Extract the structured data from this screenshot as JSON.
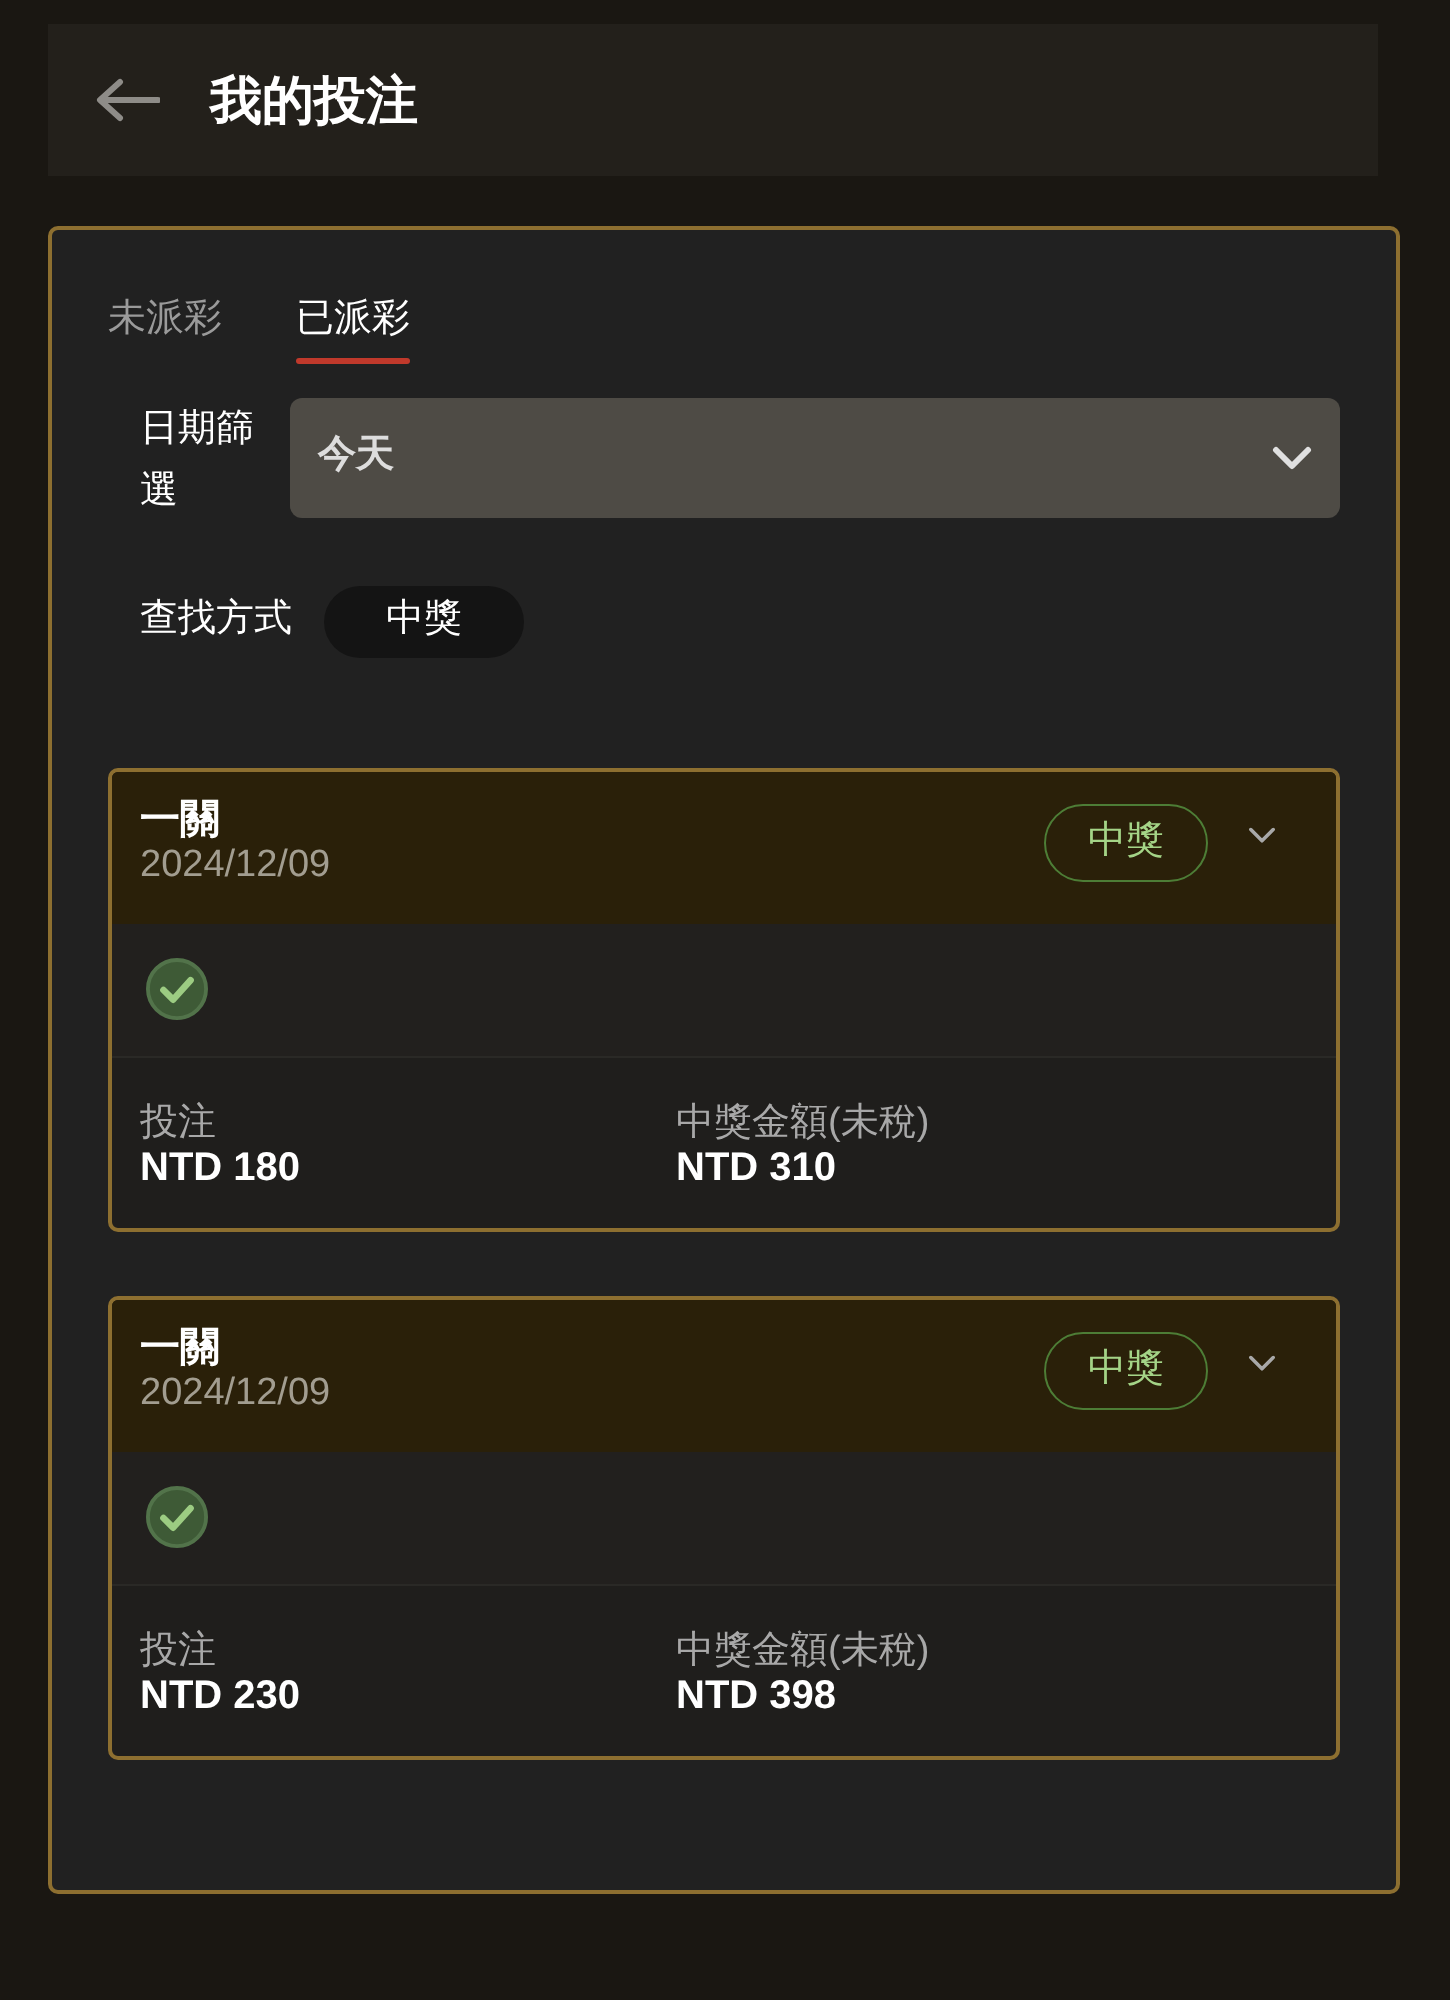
{
  "header": {
    "title": "我的投注"
  },
  "tabs": [
    {
      "label": "未派彩",
      "selected": false
    },
    {
      "label": "已派彩",
      "selected": true
    }
  ],
  "date_filter": {
    "label": "日期篩選",
    "value": "今天"
  },
  "search_method": {
    "label": "查找方式",
    "value": "中獎"
  },
  "bets": [
    {
      "title": "一關",
      "date": "2024/12/09",
      "status": {
        "label": "中獎",
        "kind": "won"
      },
      "legs": [
        {
          "won": true
        }
      ],
      "stake_label": "投注",
      "stake": "NTD 180",
      "payout_label": "中獎金額(未稅)",
      "payout": "NTD 310"
    },
    {
      "title": "一關",
      "date": "2024/12/09",
      "status": {
        "label": "中獎",
        "kind": "won"
      },
      "legs": [
        {
          "won": true
        }
      ],
      "stake_label": "投注",
      "stake": "NTD 230",
      "payout_label": "中獎金額(未稅)",
      "payout": "NTD 398"
    }
  ]
}
